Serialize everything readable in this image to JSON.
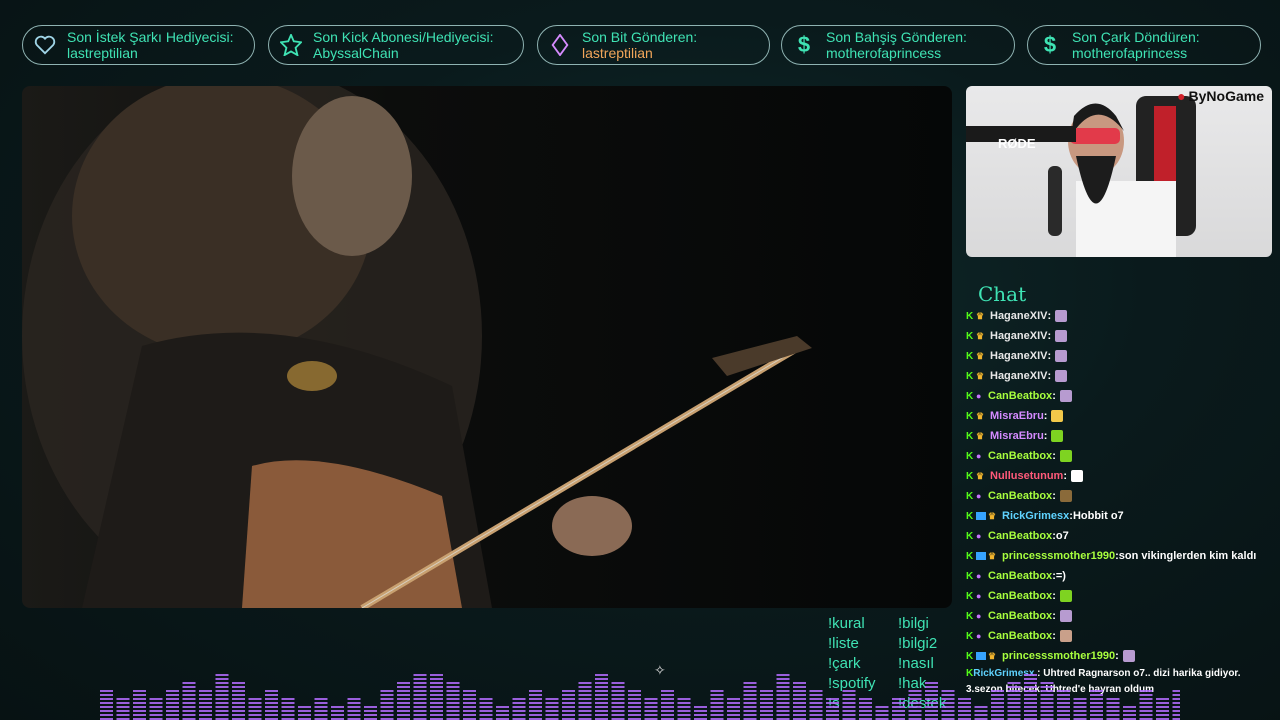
{
  "alerts": [
    {
      "label": "Son İstek Şarkı Hediyecisi:",
      "value": "lastreptilian",
      "icon": "heart-icon",
      "color": "#3fe3b4"
    },
    {
      "label": "Son Kick Abonesi/Hediyecisi:",
      "value": "AbyssalChain",
      "icon": "star-icon",
      "color": "#3fe3b4"
    },
    {
      "label": "Son Bit Gönderen:",
      "value": "lastreptilian",
      "icon": "diamond-icon",
      "color": "#f2a65a"
    },
    {
      "label": "Son Bahşiş Gönderen:",
      "value": "motherofaprincess",
      "icon": "dollar-icon",
      "color": "#3fe3b4"
    },
    {
      "label": "Son Çark Döndüren:",
      "value": "motherofaprincess",
      "icon": "dollar-icon",
      "color": "#3fe3b4"
    }
  ],
  "webcam": {
    "brand": "ByNoGame",
    "mic_label": "RØDE"
  },
  "chat": {
    "title": "Chat",
    "messages": [
      {
        "user": "HaganeXIV",
        "text": "",
        "color": "#e8e8e8",
        "badges": [
          "kick",
          "crown"
        ],
        "emote": "#b79bd0"
      },
      {
        "user": "HaganeXIV",
        "text": "",
        "color": "#e8e8e8",
        "badges": [
          "kick",
          "crown"
        ],
        "emote": "#b79bd0"
      },
      {
        "user": "HaganeXIV",
        "text": "",
        "color": "#e8e8e8",
        "badges": [
          "kick",
          "crown"
        ],
        "emote": "#b79bd0"
      },
      {
        "user": "HaganeXIV",
        "text": "",
        "color": "#e8e8e8",
        "badges": [
          "kick",
          "crown"
        ],
        "emote": "#b79bd0"
      },
      {
        "user": "CanBeatbox",
        "text": "",
        "color": "#a8ff3e",
        "badges": [
          "kick",
          "mic"
        ],
        "emote": "#b79bd0"
      },
      {
        "user": "MisraEbru",
        "text": "",
        "color": "#d58bff",
        "badges": [
          "kick",
          "crown"
        ],
        "emote": "#f2c84a"
      },
      {
        "user": "MisraEbru",
        "text": "",
        "color": "#d58bff",
        "badges": [
          "kick",
          "crown"
        ],
        "emote": "#7ed321"
      },
      {
        "user": "CanBeatbox",
        "text": "",
        "color": "#a8ff3e",
        "badges": [
          "kick",
          "mic"
        ],
        "emote": "#7ed321"
      },
      {
        "user": "Nullusetunum",
        "text": "",
        "color": "#ff5a7a",
        "badges": [
          "kick",
          "crown"
        ],
        "emote": "#ffffff"
      },
      {
        "user": "CanBeatbox",
        "text": "",
        "color": "#a8ff3e",
        "badges": [
          "kick",
          "mic"
        ],
        "emote": "#8a6a3a"
      },
      {
        "user": "RickGrimesx",
        "text": "Hobbit o7",
        "color": "#5fd3ff",
        "badges": [
          "kick",
          "prime",
          "crown"
        ],
        "emote": ""
      },
      {
        "user": "CanBeatbox",
        "text": "o7",
        "color": "#a8ff3e",
        "badges": [
          "kick",
          "mic"
        ],
        "emote": ""
      },
      {
        "user": "princesssmother1990",
        "text": "son vikinglerden kim kaldı",
        "color": "#a8ff3e",
        "badges": [
          "kick",
          "prime",
          "crown"
        ],
        "emote": ""
      },
      {
        "user": "CanBeatbox",
        "text": "=)",
        "color": "#a8ff3e",
        "badges": [
          "kick",
          "mic"
        ],
        "emote": ""
      },
      {
        "user": "CanBeatbox",
        "text": "",
        "color": "#a8ff3e",
        "badges": [
          "kick",
          "mic"
        ],
        "emote": "#7ed321"
      },
      {
        "user": "CanBeatbox",
        "text": "",
        "color": "#a8ff3e",
        "badges": [
          "kick",
          "mic"
        ],
        "emote": "#b79bd0"
      },
      {
        "user": "CanBeatbox",
        "text": "",
        "color": "#a8ff3e",
        "badges": [
          "kick",
          "mic"
        ],
        "emote": "#c9a08a"
      },
      {
        "user": "princesssmother1990",
        "text": "",
        "color": "#a8ff3e",
        "badges": [
          "kick",
          "prime",
          "crown"
        ],
        "emote": "#b79bd0"
      }
    ],
    "last": {
      "user": "RickGrimesx",
      "text": "Uhtred Ragnarson o7.. dizi harika gidiyor. 3.sezon bitecek. Uhtred'e hayran oldum",
      "color": "#5fd3ff"
    }
  },
  "commands": {
    "col1": [
      "!kural",
      "!liste",
      "!çark",
      "!spotify",
      "!s"
    ],
    "col2": [
      "!bilgi",
      "!bilgi2",
      "!nasıl",
      "!hak",
      "!destek"
    ]
  },
  "colors": {
    "accent": "#3fe3b4",
    "eq": "#b46cff"
  }
}
